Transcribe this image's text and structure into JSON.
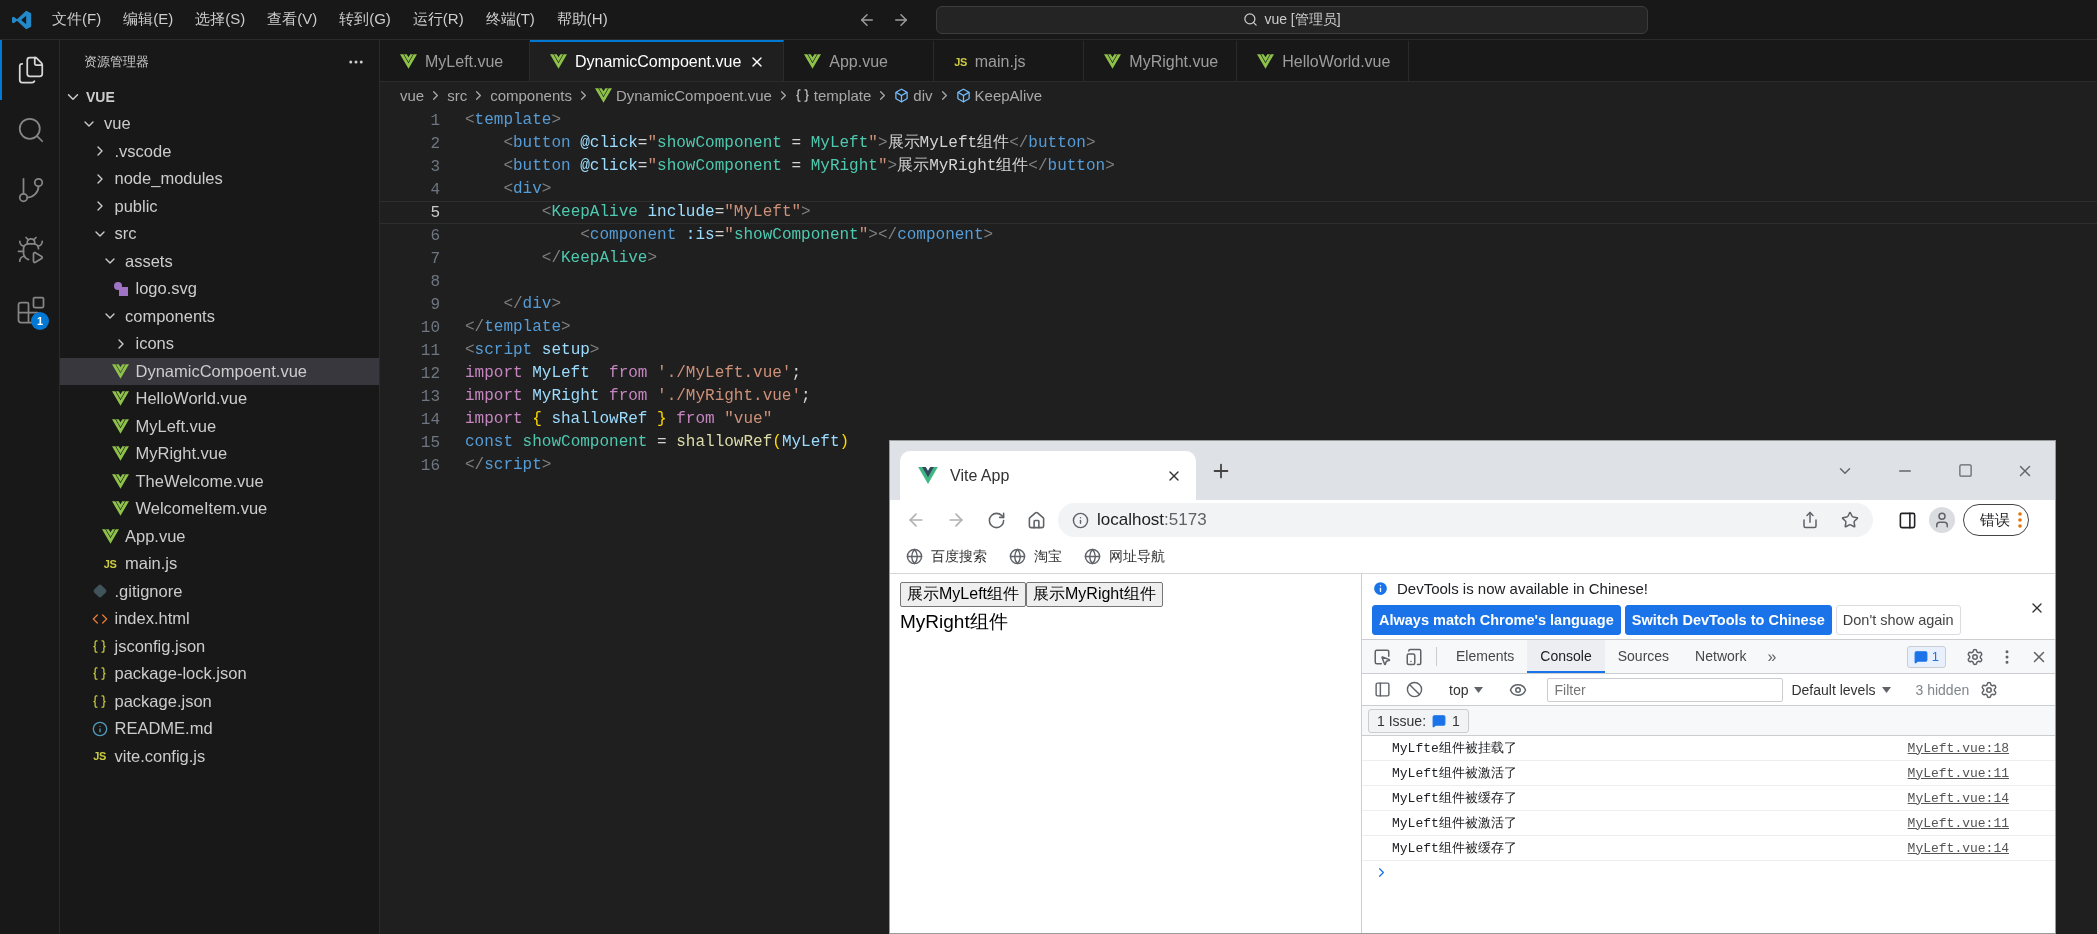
{
  "title_bar": {
    "menu": [
      "文件(F)",
      "编辑(E)",
      "选择(S)",
      "查看(V)",
      "转到(G)",
      "运行(R)",
      "终端(T)",
      "帮助(H)"
    ],
    "command_center": "vue [管理员]"
  },
  "activity_bar": [
    {
      "kind": "files",
      "selected": true
    },
    {
      "kind": "search",
      "selected": false
    },
    {
      "kind": "source-control",
      "selected": false
    },
    {
      "kind": "run-debug",
      "selected": false
    },
    {
      "kind": "extensions",
      "selected": false,
      "badge": "1"
    }
  ],
  "explorer": {
    "title": "资源管理器",
    "section": {
      "label": "VUE",
      "expanded": true
    },
    "tree": [
      {
        "label": "vue",
        "kind": "folder",
        "expanded": true,
        "selected": false,
        "children": [
          {
            "label": ".vscode",
            "kind": "folder",
            "expanded": false,
            "selected": false
          },
          {
            "label": "node_modules",
            "kind": "folder",
            "expanded": false,
            "selected": false
          },
          {
            "label": "public",
            "kind": "folder",
            "expanded": false,
            "selected": false
          },
          {
            "label": "src",
            "kind": "folder",
            "expanded": true,
            "selected": false,
            "children": [
              {
                "label": "assets",
                "kind": "folder",
                "expanded": true,
                "selected": false,
                "children": [
                  {
                    "label": "logo.svg",
                    "kind": "svg",
                    "selected": false
                  }
                ]
              },
              {
                "label": "components",
                "kind": "folder",
                "expanded": true,
                "selected": false,
                "children": [
                  {
                    "label": "icons",
                    "kind": "folder",
                    "expanded": false,
                    "selected": false
                  },
                  {
                    "label": "DynamicCompoent.vue",
                    "kind": "vue",
                    "selected": true
                  },
                  {
                    "label": "HelloWorld.vue",
                    "kind": "vue",
                    "selected": false
                  },
                  {
                    "label": "MyLeft.vue",
                    "kind": "vue",
                    "selected": false
                  },
                  {
                    "label": "MyRight.vue",
                    "kind": "vue",
                    "selected": false
                  },
                  {
                    "label": "TheWelcome.vue",
                    "kind": "vue",
                    "selected": false
                  },
                  {
                    "label": "WelcomeItem.vue",
                    "kind": "vue",
                    "selected": false
                  }
                ]
              },
              {
                "label": "App.vue",
                "kind": "vue",
                "selected": false
              },
              {
                "label": "main.js",
                "kind": "js",
                "icon_text": "JS",
                "selected": false
              }
            ]
          },
          {
            "label": ".gitignore",
            "kind": "git",
            "selected": false
          },
          {
            "label": "index.html",
            "kind": "html",
            "selected": false
          },
          {
            "label": "jsconfig.json",
            "kind": "json",
            "selected": false
          },
          {
            "label": "package-lock.json",
            "kind": "json",
            "selected": false
          },
          {
            "label": "package.json",
            "kind": "json",
            "selected": false
          },
          {
            "label": "README.md",
            "kind": "info",
            "selected": false
          },
          {
            "label": "vite.config.js",
            "kind": "js",
            "icon_text": "JS",
            "selected": false
          }
        ]
      }
    ]
  },
  "tabs": [
    {
      "label": "MyLeft.vue",
      "kind": "vue",
      "selected": false
    },
    {
      "label": "DynamicCompoent.vue",
      "kind": "vue",
      "selected": true
    },
    {
      "label": "App.vue",
      "kind": "vue",
      "selected": false
    },
    {
      "label": "main.js",
      "kind": "js",
      "icon_text": "JS",
      "selected": false
    },
    {
      "label": "MyRight.vue",
      "kind": "vue",
      "selected": false
    },
    {
      "label": "HelloWorld.vue",
      "kind": "vue",
      "selected": false
    }
  ],
  "breadcrumb": [
    {
      "label": "vue",
      "kind": "folder"
    },
    {
      "label": "src",
      "kind": "folder"
    },
    {
      "label": "components",
      "kind": "folder"
    },
    {
      "label": "DynamicCompoent.vue",
      "kind": "vue"
    },
    {
      "label": "template",
      "kind": "braces"
    },
    {
      "label": "div",
      "kind": "element"
    },
    {
      "label": "KeepAlive",
      "kind": "element"
    }
  ],
  "editor": {
    "lines": [
      {
        "number": "1",
        "current": false,
        "tokens": [
          {
            "text": "<",
            "kind": "punct"
          },
          {
            "text": "template",
            "kind": "tag"
          },
          {
            "text": ">",
            "kind": "punct"
          }
        ]
      },
      {
        "number": "2",
        "current": false,
        "tokens": [
          {
            "text": "    <",
            "kind": "punct"
          },
          {
            "text": "button",
            "kind": "tag"
          },
          {
            "text": " @click",
            "kind": "attr"
          },
          {
            "text": "=",
            "kind": "text"
          },
          {
            "text": "\"",
            "kind": "str"
          },
          {
            "text": "showComponent",
            "kind": "expr"
          },
          {
            "text": " = ",
            "kind": "text"
          },
          {
            "text": "MyLeft",
            "kind": "expr"
          },
          {
            "text": "\"",
            "kind": "str"
          },
          {
            "text": ">",
            "kind": "punct"
          },
          {
            "text": "展示MyLeft组件",
            "kind": "text"
          },
          {
            "text": "</",
            "kind": "punct"
          },
          {
            "text": "button",
            "kind": "tag"
          },
          {
            "text": ">",
            "kind": "punct"
          }
        ]
      },
      {
        "number": "3",
        "current": false,
        "tokens": [
          {
            "text": "    <",
            "kind": "punct"
          },
          {
            "text": "button",
            "kind": "tag"
          },
          {
            "text": " @click",
            "kind": "attr"
          },
          {
            "text": "=",
            "kind": "text"
          },
          {
            "text": "\"",
            "kind": "str"
          },
          {
            "text": "showComponent",
            "kind": "expr"
          },
          {
            "text": " = ",
            "kind": "text"
          },
          {
            "text": "MyRight",
            "kind": "expr"
          },
          {
            "text": "\"",
            "kind": "str"
          },
          {
            "text": ">",
            "kind": "punct"
          },
          {
            "text": "展示MyRight组件",
            "kind": "text"
          },
          {
            "text": "</",
            "kind": "punct"
          },
          {
            "text": "button",
            "kind": "tag"
          },
          {
            "text": ">",
            "kind": "punct"
          }
        ]
      },
      {
        "number": "4",
        "current": false,
        "tokens": [
          {
            "text": "    <",
            "kind": "punct"
          },
          {
            "text": "div",
            "kind": "tag"
          },
          {
            "text": ">",
            "kind": "punct"
          }
        ]
      },
      {
        "number": "5",
        "current": true,
        "tokens": [
          {
            "text": "        <",
            "kind": "punct"
          },
          {
            "text": "KeepAlive",
            "kind": "comp"
          },
          {
            "text": " include",
            "kind": "attr"
          },
          {
            "text": "=",
            "kind": "text"
          },
          {
            "text": "\"MyLeft\"",
            "kind": "str"
          },
          {
            "text": ">",
            "kind": "punct"
          }
        ]
      },
      {
        "number": "6",
        "current": false,
        "tokens": [
          {
            "text": "            <",
            "kind": "punct"
          },
          {
            "text": "component",
            "kind": "tag"
          },
          {
            "text": " :is",
            "kind": "attr"
          },
          {
            "text": "=",
            "kind": "text"
          },
          {
            "text": "\"",
            "kind": "str"
          },
          {
            "text": "showComponent",
            "kind": "expr"
          },
          {
            "text": "\"",
            "kind": "str"
          },
          {
            "text": "></",
            "kind": "punct"
          },
          {
            "text": "component",
            "kind": "tag"
          },
          {
            "text": ">",
            "kind": "punct"
          }
        ]
      },
      {
        "number": "7",
        "current": false,
        "tokens": [
          {
            "text": "        </",
            "kind": "punct"
          },
          {
            "text": "KeepAlive",
            "kind": "comp"
          },
          {
            "text": ">",
            "kind": "punct"
          }
        ]
      },
      {
        "number": "8",
        "current": false
      },
      {
        "number": "9",
        "current": false,
        "tokens": [
          {
            "text": "    </",
            "kind": "punct"
          },
          {
            "text": "div",
            "kind": "tag"
          },
          {
            "text": ">",
            "kind": "punct"
          }
        ]
      },
      {
        "number": "10",
        "current": false,
        "tokens": [
          {
            "text": "</",
            "kind": "punct"
          },
          {
            "text": "template",
            "kind": "tag"
          },
          {
            "text": ">",
            "kind": "punct"
          }
        ]
      },
      {
        "number": "11",
        "current": false,
        "tokens": [
          {
            "text": "<",
            "kind": "punct"
          },
          {
            "text": "script",
            "kind": "tag"
          },
          {
            "text": " setup",
            "kind": "attr"
          },
          {
            "text": ">",
            "kind": "punct"
          }
        ]
      },
      {
        "number": "12",
        "current": false,
        "tokens": [
          {
            "text": "import",
            "kind": "kw"
          },
          {
            "text": " MyLeft",
            "kind": "var"
          },
          {
            "text": "  from",
            "kind": "kw"
          },
          {
            "text": " './MyLeft.vue'",
            "kind": "str"
          },
          {
            "text": ";",
            "kind": "text"
          }
        ]
      },
      {
        "number": "13",
        "current": false,
        "tokens": [
          {
            "text": "import",
            "kind": "kw"
          },
          {
            "text": " MyRight",
            "kind": "var"
          },
          {
            "text": " from",
            "kind": "kw"
          },
          {
            "text": " './MyRight.vue'",
            "kind": "str"
          },
          {
            "text": ";",
            "kind": "text"
          }
        ]
      },
      {
        "number": "14",
        "current": false,
        "tokens": [
          {
            "text": "import",
            "kind": "kw"
          },
          {
            "text": " {",
            "kind": "brace"
          },
          {
            "text": " shallowRef",
            "kind": "var"
          },
          {
            "text": " }",
            "kind": "brace"
          },
          {
            "text": " from",
            "kind": "kw"
          },
          {
            "text": " \"vue\"",
            "kind": "str"
          }
        ]
      },
      {
        "number": "15",
        "current": false,
        "tokens": [
          {
            "text": "const",
            "kind": "storage"
          },
          {
            "text": " showComponent",
            "kind": "expr"
          },
          {
            "text": " = ",
            "kind": "text"
          },
          {
            "text": "shallowRef",
            "kind": "fn"
          },
          {
            "text": "(",
            "kind": "brace"
          },
          {
            "text": "MyLeft",
            "kind": "var"
          },
          {
            "text": ")",
            "kind": "brace"
          }
        ]
      },
      {
        "number": "16",
        "current": false,
        "tokens": [
          {
            "text": "</",
            "kind": "punct"
          },
          {
            "text": "script",
            "kind": "tag"
          },
          {
            "text": ">",
            "kind": "punct"
          }
        ]
      }
    ]
  },
  "browser": {
    "tab": {
      "title": "Vite App"
    },
    "address": {
      "host": "localhost",
      "port": ":5173"
    },
    "profile_button": "错误",
    "bookmarks": [
      "百度搜索",
      "淘宝",
      "网址导航"
    ],
    "page": {
      "buttons": [
        "展示MyLeft组件",
        "展示MyRight组件"
      ],
      "text": "MyRight组件"
    },
    "devtools": {
      "notice": "DevTools is now available in Chinese!",
      "notice_buttons": [
        {
          "label": "Always match Chrome's language",
          "kind": "primary"
        },
        {
          "label": "Switch DevTools to Chinese",
          "kind": "primary"
        },
        {
          "label": "Don't show again",
          "kind": "plain"
        }
      ],
      "tabs": [
        {
          "label": "Elements",
          "selected": false
        },
        {
          "label": "Console",
          "selected": true
        },
        {
          "label": "Sources",
          "selected": false
        },
        {
          "label": "Network",
          "selected": false
        }
      ],
      "more_tabs": "»",
      "issue_count": "1",
      "context": "top",
      "filter_placeholder": "Filter",
      "levels": "Default levels",
      "hidden": "3 hidden",
      "issues_label": "1 Issue:",
      "issues_count": "1",
      "messages": [
        {
          "text": "MyLfte组件被挂载了",
          "source": "MyLeft.vue:18"
        },
        {
          "text": "MyLeft组件被激活了",
          "source": "MyLeft.vue:11"
        },
        {
          "text": "MyLeft组件被缓存了",
          "source": "MyLeft.vue:14"
        },
        {
          "text": "MyLeft组件被激活了",
          "source": "MyLeft.vue:11"
        },
        {
          "text": "MyLeft组件被缓存了",
          "source": "MyLeft.vue:14"
        }
      ]
    }
  }
}
